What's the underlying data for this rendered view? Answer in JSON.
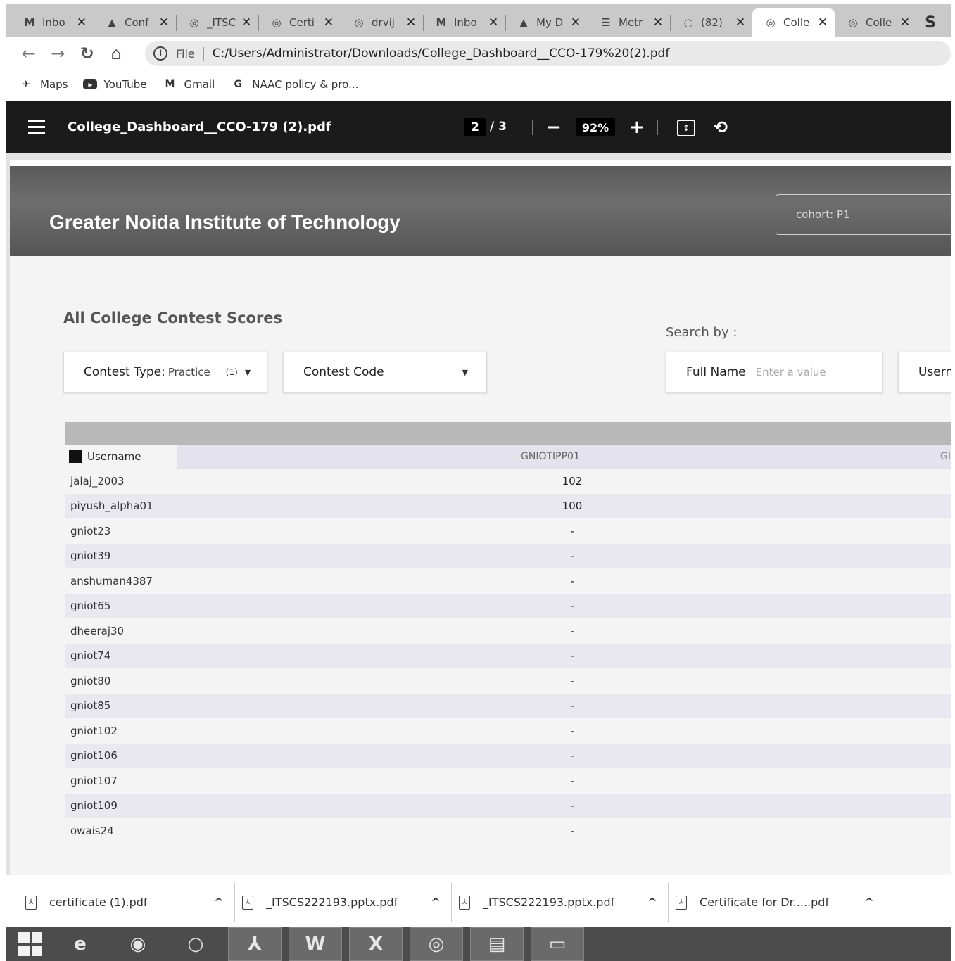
{
  "browser": {
    "tabs": [
      {
        "icon": "M",
        "icon_name": "gmail-icon",
        "title": "Inbo",
        "active": false
      },
      {
        "icon": "▲",
        "icon_name": "drive-icon",
        "title": "Conf",
        "active": false
      },
      {
        "icon": "◎",
        "icon_name": "globe-icon",
        "title": "_ITSC",
        "active": false
      },
      {
        "icon": "◎",
        "icon_name": "globe-icon",
        "title": "Certi",
        "active": false
      },
      {
        "icon": "◎",
        "icon_name": "globe-icon",
        "title": "drvij",
        "active": false
      },
      {
        "icon": "M",
        "icon_name": "gmail-icon",
        "title": "Inbo",
        "active": false
      },
      {
        "icon": "▲",
        "icon_name": "drive-icon",
        "title": "My D",
        "active": false
      },
      {
        "icon": "☰",
        "icon_name": "document-icon",
        "title": "Metr",
        "active": false
      },
      {
        "icon": "◌",
        "icon_name": "whatsapp-icon",
        "title": "(82)",
        "active": false
      },
      {
        "icon": "◎",
        "icon_name": "globe-icon",
        "title": "Colle",
        "active": true
      },
      {
        "icon": "◎",
        "icon_name": "globe-icon",
        "title": "Colle",
        "active": false
      }
    ],
    "extra_tab_icon": "S",
    "address": {
      "scheme": "File",
      "url": "C:/Users/Administrator/Downloads/College_Dashboard__CCO-179%20(2).pdf"
    },
    "bookmarks": [
      {
        "icon": "✈",
        "icon_name": "maps-icon",
        "label": "Maps"
      },
      {
        "icon": "▶",
        "icon_name": "youtube-icon",
        "label": "YouTube"
      },
      {
        "icon": "M",
        "icon_name": "gmail-icon",
        "label": "Gmail"
      },
      {
        "icon": "G",
        "icon_name": "google-icon",
        "label": "NAAC policy & pro..."
      }
    ]
  },
  "pdf_viewer": {
    "title": "College_Dashboard__CCO-179 (2).pdf",
    "current_page": "2",
    "total_pages": "/  3",
    "zoom": "92%"
  },
  "dashboard": {
    "college_name": "Greater Noida Institute of Technology",
    "cohort": "cohort: P1",
    "section_title": "All College Contest Scores",
    "search_by_label": "Search by :",
    "contest_type_label": "Contest Type:",
    "contest_type_value": "Practice",
    "contest_type_count": "(1)",
    "contest_code_label": "Contest Code",
    "full_name_label": "Full Name",
    "full_name_placeholder": "Enter a value",
    "username_filter_label": "Usern",
    "table": {
      "username_header": "Username",
      "contest_header": "GNIOTIPP01",
      "next_header": "GI",
      "rows": [
        {
          "username": "jalaj_2003",
          "score": "102"
        },
        {
          "username": "piyush_alpha01",
          "score": "100"
        },
        {
          "username": "gniot23",
          "score": "-"
        },
        {
          "username": "gniot39",
          "score": "-"
        },
        {
          "username": "anshuman4387",
          "score": "-"
        },
        {
          "username": "gniot65",
          "score": "-"
        },
        {
          "username": "dheeraj30",
          "score": "-"
        },
        {
          "username": "gniot74",
          "score": "-"
        },
        {
          "username": "gniot80",
          "score": "-"
        },
        {
          "username": "gniot85",
          "score": "-"
        },
        {
          "username": "gniot102",
          "score": "-"
        },
        {
          "username": "gniot106",
          "score": "-"
        },
        {
          "username": "gniot107",
          "score": "-"
        },
        {
          "username": "gniot109",
          "score": "-"
        },
        {
          "username": "owais24",
          "score": "-"
        }
      ]
    }
  },
  "downloads": [
    {
      "name": "certificate (1).pdf"
    },
    {
      "name": "_ITSCS222193.pptx.pdf"
    },
    {
      "name": "_ITSCS222193.pptx.pdf"
    },
    {
      "name": "Certificate for Dr.....pdf"
    }
  ],
  "taskbar": {
    "apps": [
      {
        "icon": "e",
        "icon_name": "internet-explorer-icon"
      },
      {
        "icon": "◉",
        "icon_name": "firefox-icon"
      },
      {
        "icon": "○",
        "icon_name": "opera-icon"
      },
      {
        "icon": "⅄",
        "icon_name": "acrobat-icon"
      },
      {
        "icon": "W",
        "icon_name": "word-icon"
      },
      {
        "icon": "X",
        "icon_name": "excel-icon"
      },
      {
        "icon": "◎",
        "icon_name": "chrome-icon"
      },
      {
        "icon": "▤",
        "icon_name": "file-explorer-icon"
      },
      {
        "icon": "▭",
        "icon_name": "window-icon"
      }
    ]
  }
}
